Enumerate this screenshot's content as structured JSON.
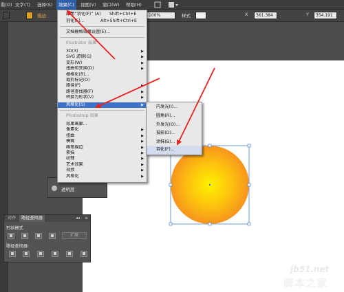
{
  "menubar": {
    "items": [
      "看(O)",
      "文字(T)",
      "选择(S)",
      "效果(C)",
      "视图(V)",
      "窗口(W)",
      "帮助(H)"
    ]
  },
  "controlbar": {
    "stroke_label": "描边",
    "opacity_value": "100%",
    "style_label": "样式",
    "x_value": "361.384",
    "y_value": "354.191"
  },
  "effect_menu": {
    "apply_last": {
      "label": "应用“羽化(F)” (A)",
      "shortcut": "Shift+Ctrl+E"
    },
    "last_effect": {
      "label": "羽化(F)...",
      "shortcut": "Alt+Shift+Ctrl+E"
    },
    "raster_settings": "文档栅格效果设置(E)...",
    "illustrator_header": "Illustrator 效果",
    "illustrator_items": [
      "3D(3)",
      "SVG 滤镜(G)",
      "变形(W)",
      "扭曲和变换(D)",
      "栅格化(R)...",
      "裁剪标记(O)",
      "路径(P)",
      "路径查找器(F)",
      "转换为形状(V)",
      "风格化(S)"
    ],
    "photoshop_header": "Photoshop 效果",
    "photoshop_items": [
      "效果画廊...",
      "像素化",
      "扭曲",
      "模糊",
      "画笔描边",
      "素描",
      "纹理",
      "艺术效果",
      "视频",
      "风格化"
    ]
  },
  "stylize_submenu": {
    "items": [
      "内发光(I)...",
      "圆角(R)...",
      "外发光(O)...",
      "投影(D)...",
      "涂抹(B)...",
      "羽化(F)..."
    ]
  },
  "appearance_panel": {
    "label": "透明度"
  },
  "pathfinder_panel": {
    "tabs": [
      "对齐",
      "路径查找器"
    ],
    "shape_modes_label": "形状模式",
    "expand_label": "扩展",
    "pathfinders_label": "路径查找器:"
  },
  "watermark": {
    "site": "jb51.net",
    "name": "脚本之家"
  },
  "colors": {
    "circle_center": "#fff200",
    "circle_edge": "#f7941d",
    "arrow": "#e8201f",
    "selection": "#4a7fd6"
  }
}
